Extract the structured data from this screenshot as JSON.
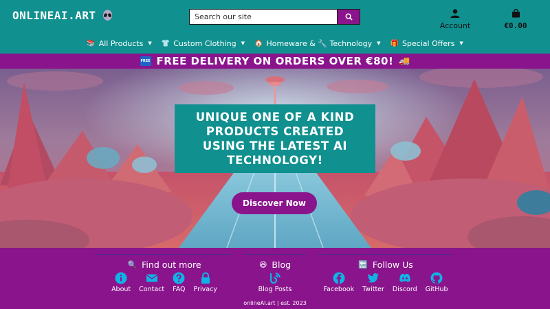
{
  "header": {
    "logo_text": "ONLINEAI.ART",
    "search": {
      "placeholder": "Search our site"
    },
    "account_label": "Account",
    "cart_total": "€0.00"
  },
  "nav": {
    "items": [
      {
        "label": "All Products",
        "emoji": "📚"
      },
      {
        "label": "Custom Clothing",
        "emoji": "👕"
      },
      {
        "label": "Homeware & 🔧 Technology",
        "emoji": "🏠"
      },
      {
        "label": "Special Offers",
        "emoji": "🎁"
      }
    ]
  },
  "banner": {
    "badge": "FREE",
    "text": "FREE DELIVERY ON ORDERS OVER €80!",
    "truck": "🚚"
  },
  "hero": {
    "title": "UNIQUE ONE OF A KIND PRODUCTS CREATED USING THE LATEST AI TECHNOLOGY!",
    "cta_label": "Discover Now"
  },
  "footer": {
    "find_out_more": {
      "title": "Find out more",
      "icon": "🔍",
      "links": [
        "About",
        "Contact",
        "FAQ",
        "Privacy"
      ]
    },
    "blog": {
      "title": "Blog",
      "icon": "😆",
      "links": [
        "Blog Posts"
      ]
    },
    "follow_us": {
      "title": "Follow Us",
      "icon": "🔚",
      "links": [
        "Facebook",
        "Twitter",
        "Discord",
        "GitHub"
      ]
    },
    "copyright": "onlineAI.art | est. 2023"
  },
  "colors": {
    "teal": "#10908f",
    "purple": "#8a148c",
    "accent_text": "#ffffff"
  }
}
